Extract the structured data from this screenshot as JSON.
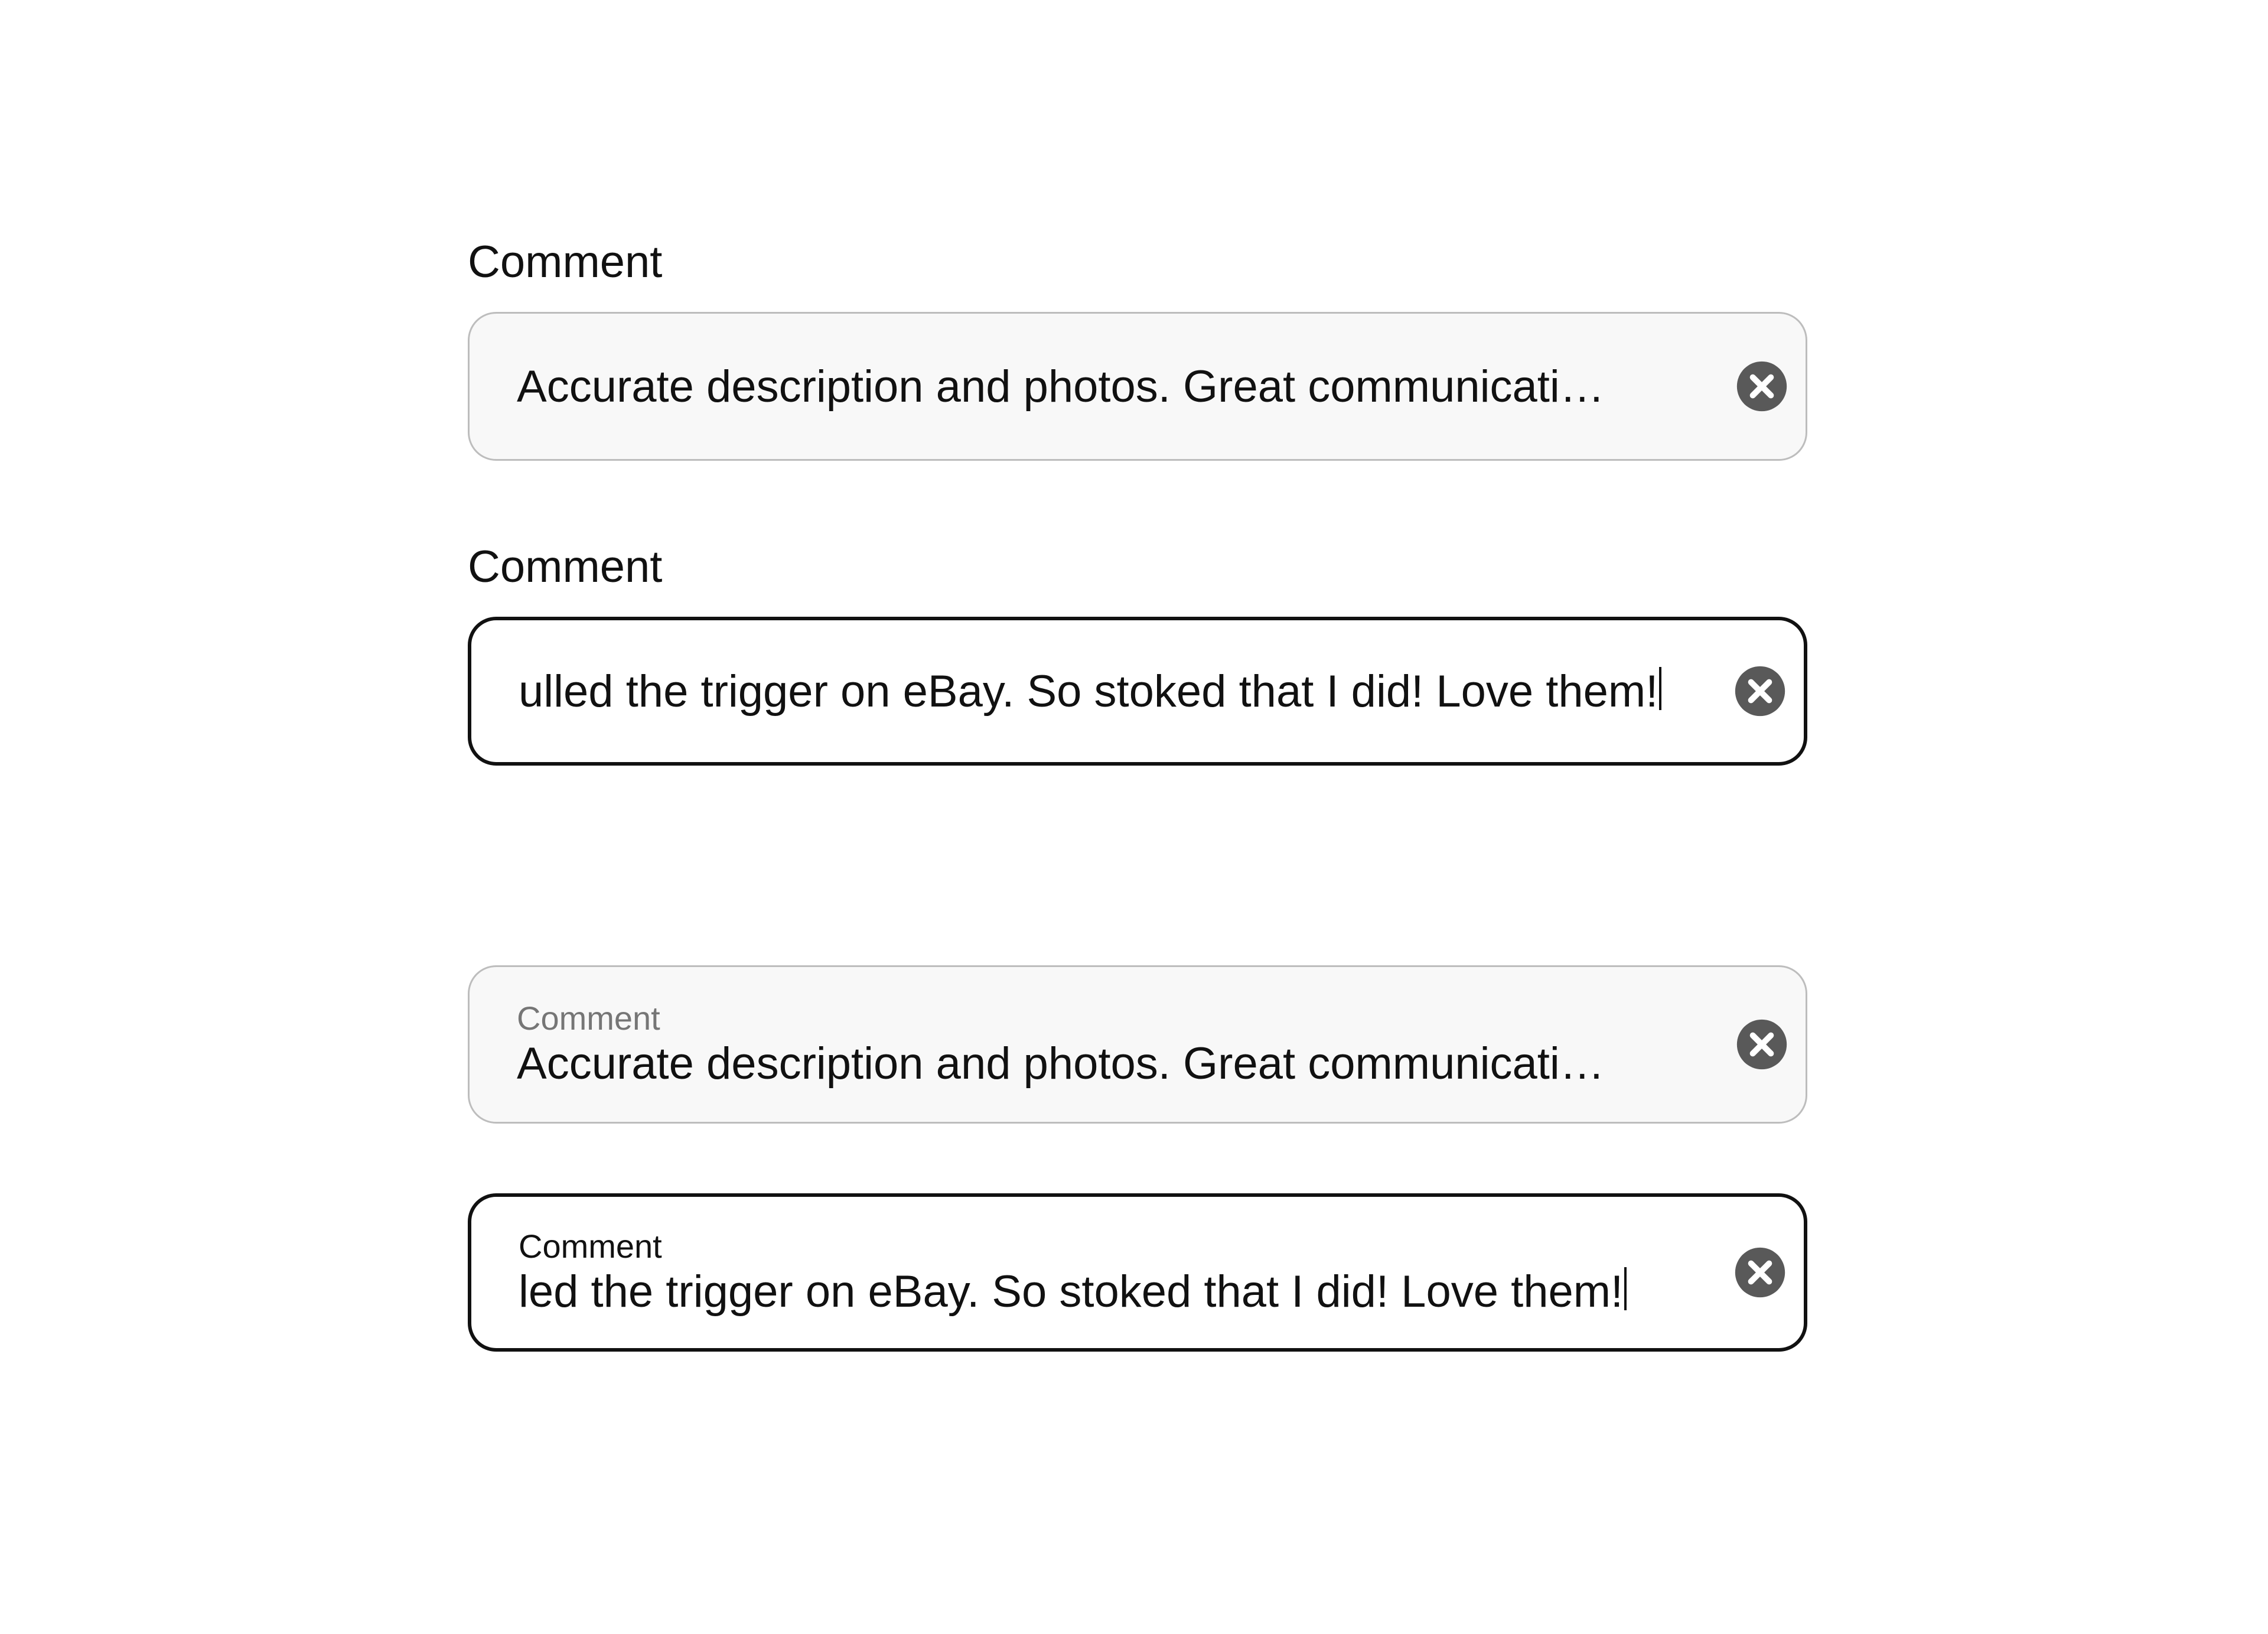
{
  "labels": {
    "comment": "Comment"
  },
  "icons": {
    "clear": "clear-icon"
  },
  "colors": {
    "clear_icon": "#595959",
    "border_resting": "#bdbdbd",
    "border_focused": "#111111",
    "bg_resting": "#f8f8f8",
    "text": "#111111",
    "float_label_resting": "#767676"
  },
  "fields": [
    {
      "id": "comment-1",
      "variant": "label-above",
      "state": "resting",
      "truncated_display": "Accurate description and photos. Great communicati…",
      "value": "Accurate description and photos. Great communication."
    },
    {
      "id": "comment-2",
      "variant": "label-above",
      "state": "focused",
      "scrolled_tail_display": "ulled the trigger on eBay. So stoked that I did! Love them!",
      "value": "Pulled the trigger on eBay. So stoked that I did! Love them!"
    },
    {
      "id": "comment-3",
      "variant": "float-label",
      "state": "resting",
      "truncated_display": "Accurate description and photos. Great communicati…",
      "value": "Accurate description and photos. Great communication."
    },
    {
      "id": "comment-4",
      "variant": "float-label",
      "state": "focused",
      "scrolled_tail_display": "led the trigger on eBay. So stoked that I did! Love them!",
      "value": "Pulled the trigger on eBay. So stoked that I did! Love them!"
    }
  ]
}
